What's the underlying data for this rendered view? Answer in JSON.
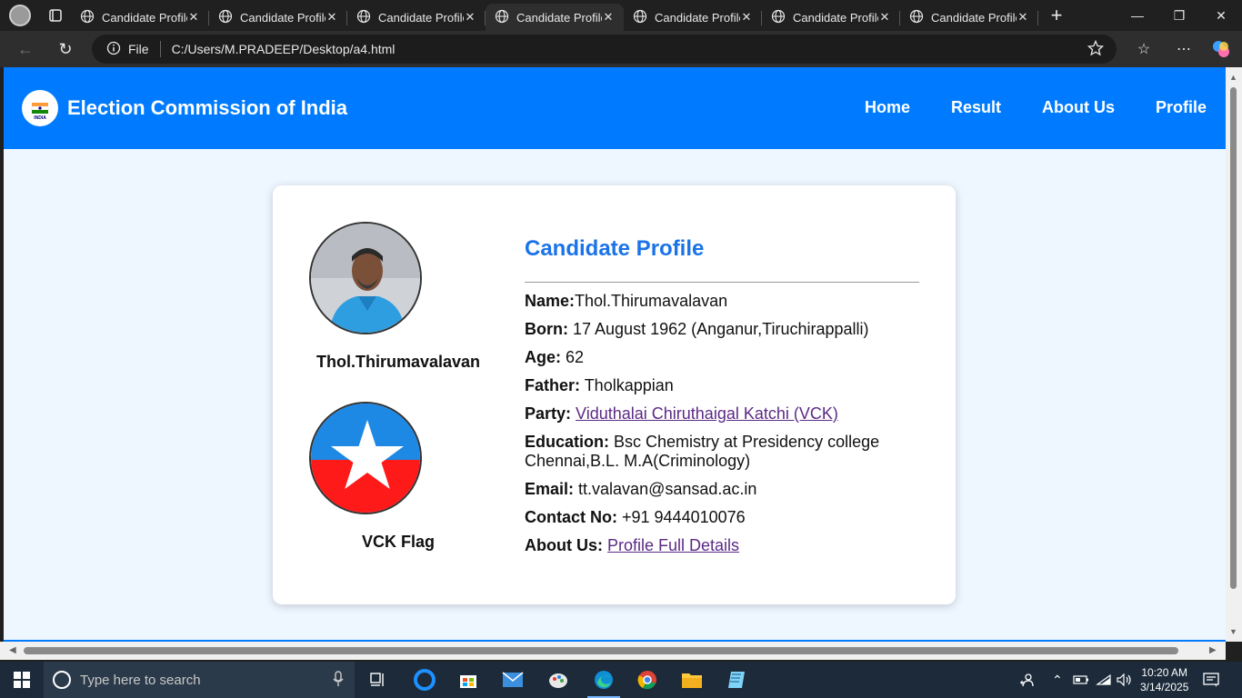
{
  "browser": {
    "tabs": [
      {
        "title": "Candidate Profile",
        "active": false
      },
      {
        "title": "Candidate Profile",
        "active": false
      },
      {
        "title": "Candidate Profile",
        "active": false
      },
      {
        "title": "Candidate Profile",
        "active": true
      },
      {
        "title": "Candidate Profile",
        "active": false
      },
      {
        "title": "Candidate Profile",
        "active": false
      },
      {
        "title": "Candidate Profile",
        "active": false
      }
    ],
    "address": {
      "scheme_label": "File",
      "url": "C:/Users/M.PRADEEP/Desktop/a4.html"
    }
  },
  "site": {
    "title": "Election Commission of India",
    "nav": [
      "Home",
      "Result",
      "About Us",
      "Profile"
    ],
    "logo_text": "INDIA"
  },
  "profile": {
    "photo_caption": "Thol.Thirumavalavan",
    "flag_caption": "VCK Flag",
    "heading": "Candidate Profile",
    "fields": [
      {
        "label": "Name:",
        "value": "Thol.Thirumavalavan"
      },
      {
        "label": "Born:",
        "value": " 17 August 1962 (Anganur,Tiruchirappalli)"
      },
      {
        "label": "Age:",
        "value": " 62"
      },
      {
        "label": "Father:",
        "value": " Tholkappian"
      },
      {
        "label": "Party:",
        "link": "Viduthalai Chiruthaigal Katchi (VCK)"
      },
      {
        "label": "Education:",
        "value": " Bsc Chemistry at Presidency college Chennai,B.L. M.A(Criminology)"
      },
      {
        "label": "Email:",
        "value": " tt.valavan@sansad.ac.in"
      },
      {
        "label": "Contact No:",
        "value": " +91 9444010076"
      },
      {
        "label": "About Us:",
        "link": "Profile Full Details"
      }
    ]
  },
  "taskbar": {
    "search_placeholder": "Type here to search",
    "time": "10:20 AM",
    "date": "3/14/2025"
  },
  "colors": {
    "header_blue": "#007bff",
    "heading_blue": "#1a73e8",
    "link_purple": "#5b2a86",
    "flag_top": "#1e88e5",
    "flag_bottom": "#ff1a1a"
  }
}
